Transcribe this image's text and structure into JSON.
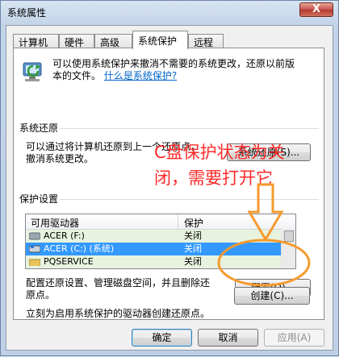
{
  "window": {
    "title": "系统属性",
    "close_glyph": "X"
  },
  "tabs": [
    {
      "label": "计算机名"
    },
    {
      "label": "硬件"
    },
    {
      "label": "高级"
    },
    {
      "label": "系统保护"
    },
    {
      "label": "远程"
    }
  ],
  "intro": {
    "line1": "可以使用系统保护来撤消不需要的系统更改，还原以前版",
    "line2_prefix": "本的文件。",
    "link": "什么是系统保护?"
  },
  "restore": {
    "heading": "系统还原",
    "line1": "可以通过将计算机还原到上一个还原点，",
    "line2": "撤消系统更改。",
    "button": "系统还原(S)..."
  },
  "protection": {
    "heading": "保护设置",
    "columns": [
      "可用驱动器",
      "保护"
    ],
    "rows": [
      {
        "drive": "ACER (F:)",
        "status": "关闭",
        "selected": false
      },
      {
        "drive": "ACER (C:) (系统)",
        "status": "关闭",
        "selected": true
      },
      {
        "drive": "PQSERVICE",
        "status": "关闭",
        "selected": false
      }
    ],
    "config_text1": "配置还原设置、管理磁盘空间，并且删除还",
    "config_text2": "原点。",
    "config_button": "配置(O)...",
    "create_text": "立刻为启用系统保护的驱动器创建还原点。",
    "create_button": "创建(C)..."
  },
  "footer": {
    "ok": "确定",
    "cancel": "取消",
    "apply": "应用(A)"
  },
  "annotation": {
    "line1": "C盘保护状态为关",
    "line2": "闭，需要打开它",
    "color": "#ff2a2a",
    "arrow_color": "#f59a2e"
  }
}
